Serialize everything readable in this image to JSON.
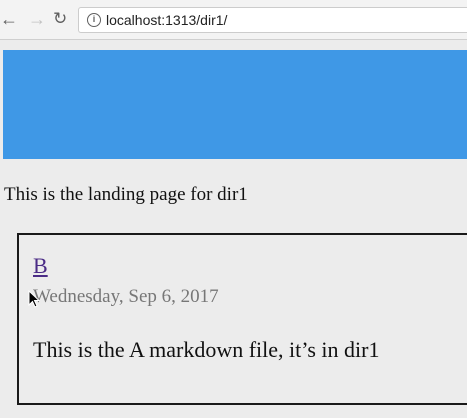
{
  "browser": {
    "back_icon": "back-arrow-icon",
    "forward_icon": "forward-arrow-icon",
    "reload_icon": "reload-icon",
    "info_icon": "info-icon",
    "url": "localhost:1313/dir1/"
  },
  "page": {
    "banner_color": "#3f98e6",
    "landing_text": "This is the landing page for dir1",
    "post": {
      "title": "B",
      "date": "Wednesday, Sep 6, 2017",
      "summary": "This is the A markdown file, it’s in dir1"
    }
  }
}
